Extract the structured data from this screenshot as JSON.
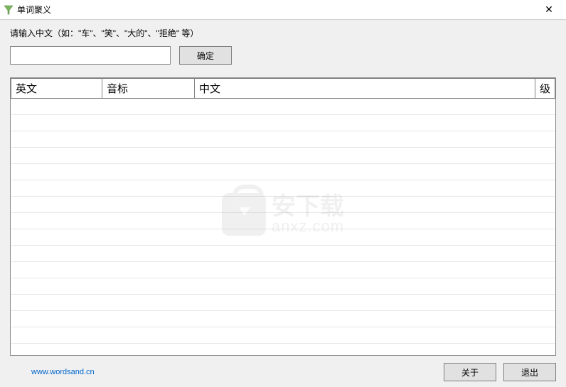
{
  "window": {
    "title": "单词聚义",
    "close_symbol": "✕"
  },
  "prompt": "请输入中文（如：\"车\"、\"笑\"、\"大的\"、\"拒绝\"  等）",
  "input": {
    "value": "",
    "placeholder": ""
  },
  "buttons": {
    "confirm": "确定",
    "about": "关于",
    "exit": "退出"
  },
  "table": {
    "headers": {
      "english": "英文",
      "phonetic": "音标",
      "chinese": "中文",
      "level": "级"
    },
    "rows": []
  },
  "footer": {
    "link_text": "www.wordsand.cn",
    "link_href": "http://www.wordsand.cn"
  },
  "watermark": {
    "top": "安下载",
    "bottom": "anxz.com"
  }
}
